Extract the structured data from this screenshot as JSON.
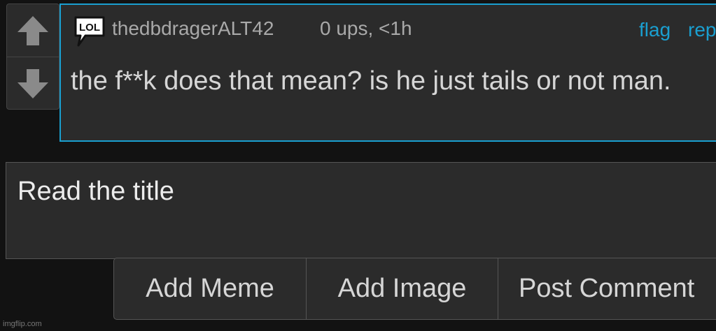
{
  "comment": {
    "username": "thedbdragerALT42",
    "meta": "0 ups, <1h",
    "flag_label": "flag",
    "reply_label": "reply",
    "text": "the f**k does that mean? is he just tails or not man.",
    "badge_icon": "lol-speech-bubble-icon",
    "badge_text": "LOL"
  },
  "voting": {
    "up_icon": "arrow-up-icon",
    "down_icon": "arrow-down-icon"
  },
  "reply_box": {
    "value": "Read the title"
  },
  "actions": {
    "add_meme_label": "Add Meme",
    "add_image_label": "Add Image",
    "post_comment_label": "Post Comment"
  },
  "watermark": "imgflip.com",
  "colors": {
    "background": "#121212",
    "panel": "#2b2b2b",
    "accent": "#1a9fd0",
    "text": "#d6d6d6",
    "muted_text": "#a9a9a9"
  }
}
